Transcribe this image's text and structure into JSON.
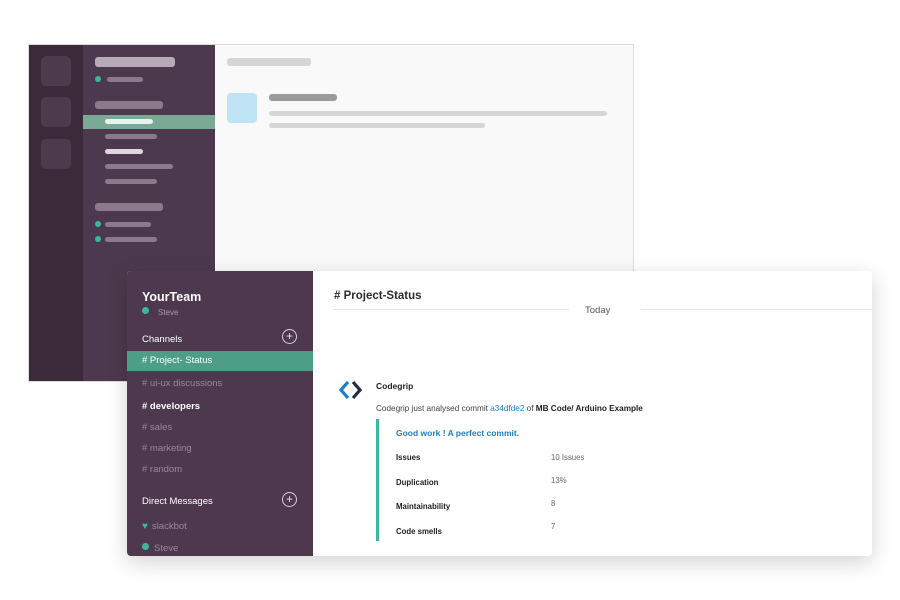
{
  "workspace": {
    "team_name": "YourTeam",
    "user_name": "Steve",
    "channels_title": "Channels",
    "channels": [
      {
        "label": "# Project- Status",
        "active": true
      },
      {
        "label": "# ui-ux discussions"
      },
      {
        "label": "# developers",
        "bold": true
      },
      {
        "label": "# sales"
      },
      {
        "label": "# marketing"
      },
      {
        "label": "# random"
      }
    ],
    "dm_title": "Direct Messages",
    "dms": [
      {
        "label": "slackbot"
      },
      {
        "label": "Steve"
      }
    ]
  },
  "channel": {
    "title": "# Project-Status",
    "date_divider": "Today"
  },
  "message": {
    "sender": "Codegrip",
    "text_prefix": "Codegrip just analysed commit ",
    "commit_link": "a34dfde2",
    "text_mid": " of ",
    "repo": "MB Code/ Arduino Example",
    "attachment_title": "Good work ! A perfect commit.",
    "fields": [
      {
        "label": "Issues",
        "value": "10 Issues"
      },
      {
        "label": "Duplication",
        "value": "13%"
      },
      {
        "label": "Maintainability",
        "value": "8"
      },
      {
        "label": "Code smells",
        "value": "7"
      }
    ]
  },
  "colors": {
    "sidebar": "#4d384d",
    "active_channel": "#4c9e87",
    "accent_green": "#3cb79c",
    "link_blue": "#1b7ec2"
  }
}
